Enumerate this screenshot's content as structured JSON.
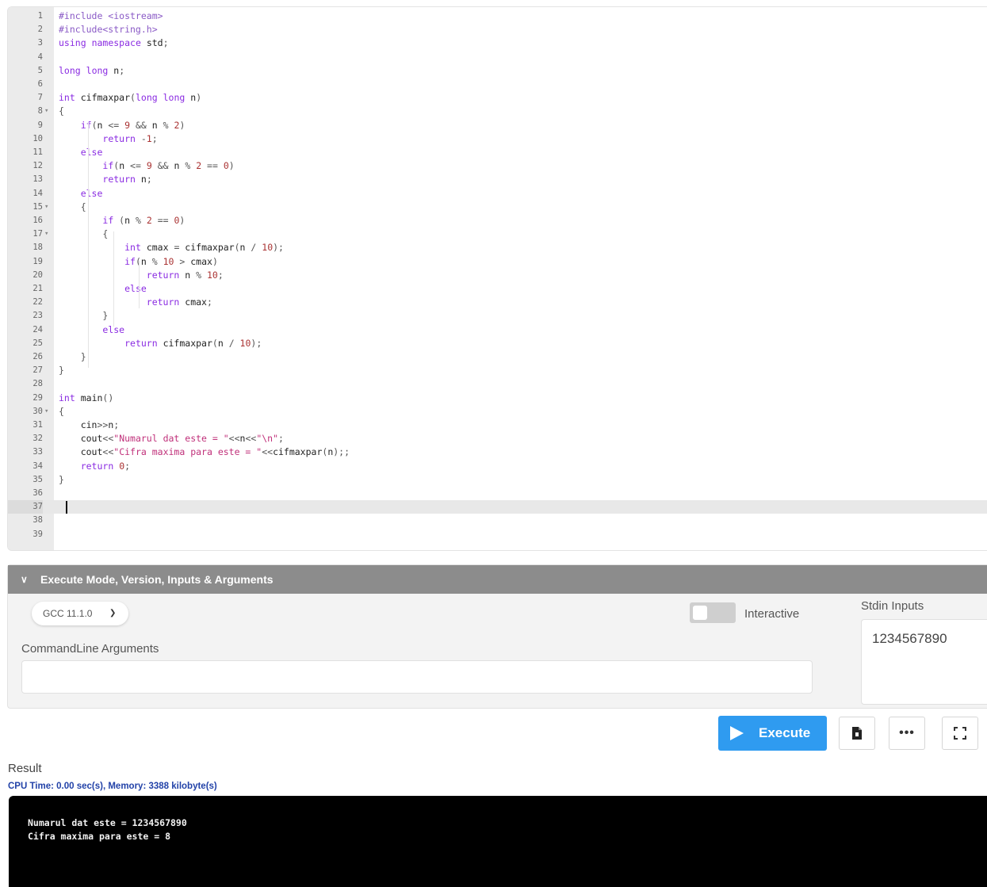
{
  "editor": {
    "lines": [
      "#include <iostream>",
      "#include<string.h>",
      "using namespace std;",
      "",
      "long long n;",
      "",
      "int cifmaxpar(long long n)",
      "{",
      "    if(n <= 9 && n % 2)",
      "        return -1;",
      "    else",
      "        if(n <= 9 && n % 2 == 0)",
      "        return n;",
      "    else",
      "    {",
      "        if (n % 2 == 0)",
      "        {",
      "            int cmax = cifmaxpar(n / 10);",
      "            if(n % 10 > cmax)",
      "                return n % 10;",
      "            else",
      "                return cmax;",
      "        }",
      "        else",
      "            return cifmaxpar(n / 10);",
      "    }",
      "}",
      "",
      "int main()",
      "{",
      "    cin>>n;",
      "    cout<<\"Numarul dat este = \"<<n<<\"\\n\";",
      "    cout<<\"Cifra maxima para este = \"<<cifmaxpar(n);;",
      "    return 0;",
      "}",
      "",
      "",
      "",
      ""
    ],
    "fold_lines": [
      8,
      15,
      17,
      30
    ],
    "active_line": 37
  },
  "execute_panel": {
    "header": "Execute Mode, Version, Inputs & Arguments",
    "version": "GCC 11.1.0",
    "interactive_label": "Interactive",
    "interactive_on": false,
    "commandline_label": "CommandLine Arguments",
    "commandline_value": "",
    "stdin_label": "Stdin Inputs",
    "stdin_value": "1234567890"
  },
  "actions": {
    "execute_label": "Execute"
  },
  "result": {
    "label": "Result",
    "stats": "CPU Time: 0.00 sec(s), Memory: 3388 kilobyte(s)",
    "output": "Numarul dat este = 1234567890\nCifra maxima para este = 8"
  }
}
